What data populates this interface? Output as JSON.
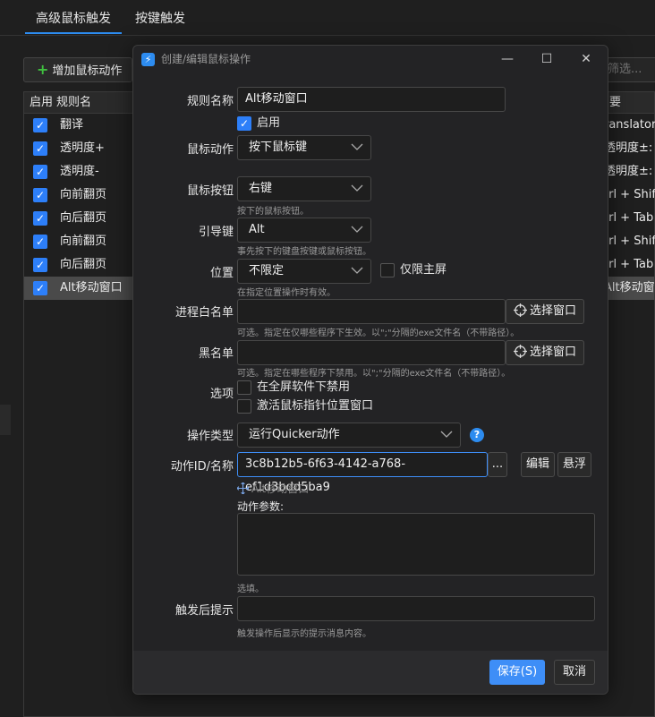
{
  "tabs": [
    "高级鼠标触发",
    "按键触发"
  ],
  "toolbar": {
    "add_label": "增加鼠标动作",
    "filter_placeholder": "筛选..."
  },
  "table": {
    "headers": [
      "启用",
      "规则名",
      "要"
    ],
    "rows": [
      {
        "name": "翻译",
        "summary": "ranslator"
      },
      {
        "name": "透明度+",
        "summary": "透明度±: +"
      },
      {
        "name": "透明度-",
        "summary": "透明度±: -"
      },
      {
        "name": "向前翻页",
        "summary": "trl + Shift"
      },
      {
        "name": "向后翻页",
        "summary": "trl + Tab"
      },
      {
        "name": "向前翻页",
        "summary": "trl + Shift"
      },
      {
        "name": "向后翻页",
        "summary": "trl + Tab"
      },
      {
        "name": "Alt移动窗口",
        "summary": "Alt移动窗口"
      }
    ]
  },
  "dialog": {
    "title": "创建/编辑鼠标操作",
    "labels": {
      "rule_name": "规则名称",
      "mouse_action": "鼠标动作",
      "mouse_button": "鼠标按钮",
      "leader_key": "引导键",
      "position": "位置",
      "whitelist": "进程白名单",
      "blacklist": "黑名单",
      "options": "选项",
      "op_type": "操作类型",
      "action_id": "动作ID/名称",
      "after_hint": "触发后提示"
    },
    "rule_name_value": "Alt移动窗口",
    "enable_label": "启用",
    "mouse_action_value": "按下鼠标键",
    "mouse_button_value": "右键",
    "mouse_button_hint": "按下的鼠标按钮。",
    "leader_key_value": "Alt",
    "leader_key_hint": "事先按下的键盘按键或鼠标按钮。",
    "position_value": "不限定",
    "primary_screen_label": "仅限主屏",
    "position_hint": "在指定位置操作时有效。",
    "pick_window_label": "选择窗口",
    "whitelist_hint": "可选。指定在仅哪些程序下生效。以\";\"分隔的exe文件名（不带路径）。",
    "blacklist_hint": "可选。指定在哪些程序下禁用。以\";\"分隔的exe文件名（不带路径）。",
    "opt_fullscreen": "在全屏软件下禁用",
    "opt_activate": "激活鼠标指针位置窗口",
    "op_type_value": "运行Quicker动作",
    "action_id_value": "3c8b12b5-6f63-4142-a768-ef1d3bdd5ba9",
    "more_label": "...",
    "edit_label": "编辑",
    "float_label": "悬浮",
    "action_name": "Alt移动窗口",
    "params_label": "动作参数:",
    "params_hint": "选填。",
    "after_hint_desc": "触发操作后显示的提示消息内容。",
    "save_label": "保存(S)",
    "cancel_label": "取消"
  },
  "colors": {
    "accent": "#2d8cf0",
    "primary_button": "#3e8ef7",
    "checkbox": "#2d7ff9"
  }
}
